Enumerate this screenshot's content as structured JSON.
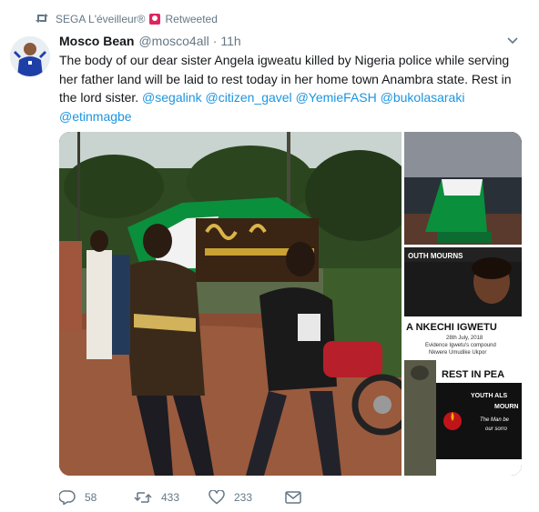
{
  "retweet_context": {
    "icon": "retweet-icon",
    "name": "SEGA L'éveilleur®",
    "badge_icon": "alarm-badge-icon",
    "label": "Retweeted"
  },
  "tweet": {
    "author_name": "Mosco Bean",
    "author_handle": "@mosco4all",
    "separator": "·",
    "time": "11h",
    "text": "The body of our dear sister Angela igweatu killed by Nigeria police while serving her father land will be laid to rest today in her home town Anambra state. Rest in the lord sister.",
    "mentions": [
      "@segalink",
      "@citizen_gavel",
      "@YemieFASH",
      "@bukolasaraki",
      "@etinmagbe"
    ]
  },
  "media": {
    "poster_top_text": "OUTH MOURNS",
    "poster_name": "A NKECHI IGWETU",
    "poster_date": "28th July, 2018",
    "poster_venue_1": "Evidence Igwetu's compound",
    "poster_venue_2": "Nkwere Umudike Ukpor",
    "poster2_title": "REST IN PEA",
    "poster2_line1": "YOUTH ALS",
    "poster2_line2": "MOURN",
    "poster2_line3": "The Man be",
    "poster2_line4": "our sorro",
    "poster2_footer": "REST IN PEA",
    "colors": {
      "flag_green": "#0a8f3c",
      "flag_white": "#f2f2f2",
      "poster_red": "#c0141a"
    }
  },
  "actions": {
    "reply_count": "58",
    "retweet_count": "433",
    "like_count": "233"
  },
  "colors": {
    "link": "#1b95e0",
    "muted": "#657786",
    "text": "#14171a"
  }
}
